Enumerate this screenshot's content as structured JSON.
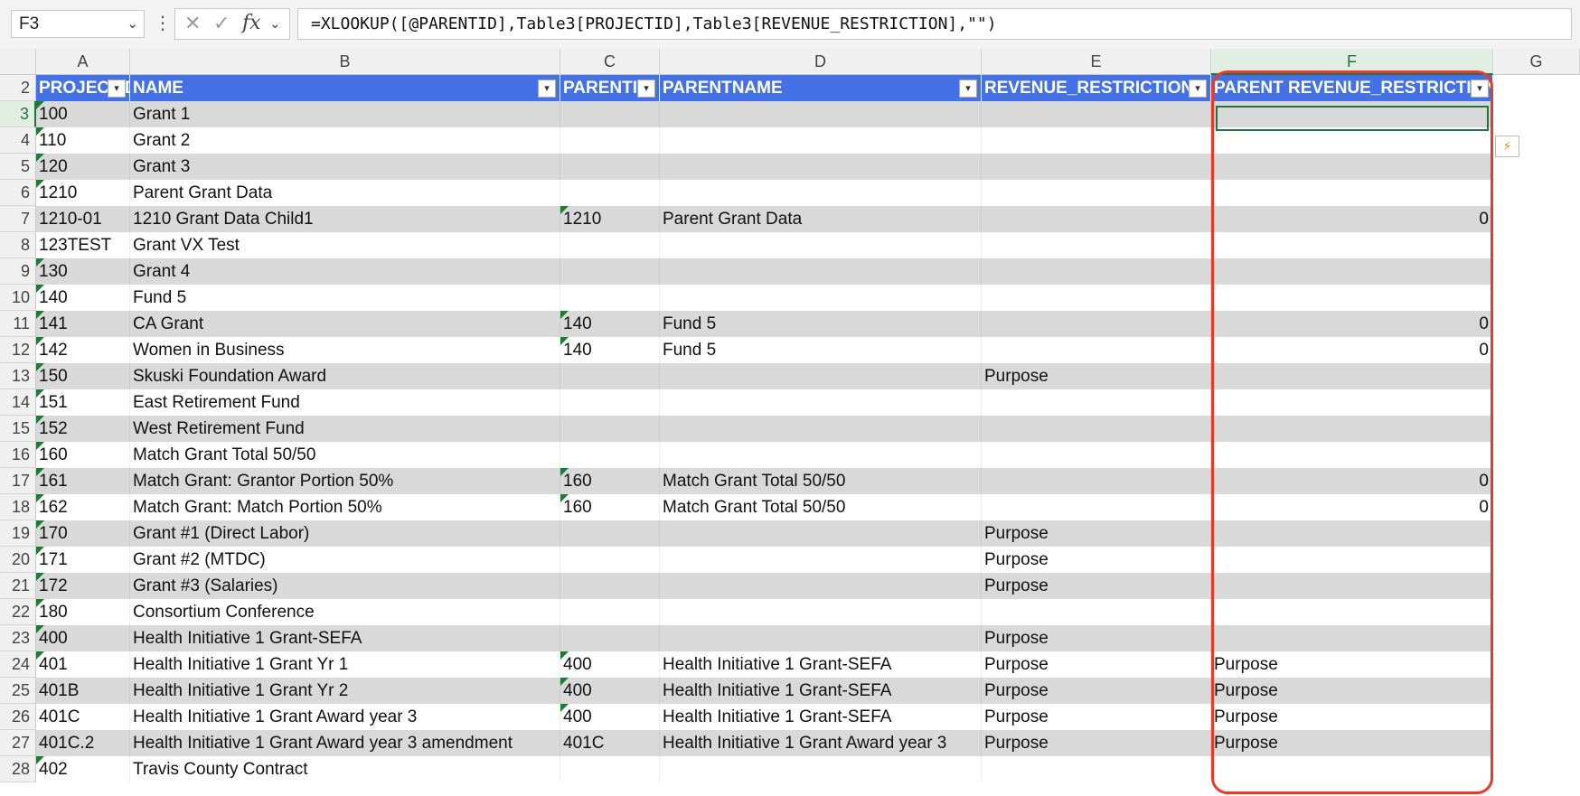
{
  "formula_bar": {
    "cell_ref": "F3",
    "cancel_icon": "✕",
    "enter_icon": "✓",
    "fx_label": "fx",
    "formula": "=XLOOKUP([@PARENTID],Table3[PROJECTID],Table3[REVENUE_RESTRICTION],\"\")"
  },
  "columns": [
    "A",
    "B",
    "C",
    "D",
    "E",
    "F",
    "G"
  ],
  "header_row": {
    "row_number": "2",
    "labels": [
      "PROJECTID",
      "NAME",
      "PARENTID",
      "PARENTNAME",
      "REVENUE_RESTRICTION",
      "PARENT REVENUE_RESTRICTION"
    ]
  },
  "rows": [
    {
      "n": "3",
      "a": "100",
      "b": "Grant 1",
      "c": "",
      "d": "",
      "e": "",
      "f": ""
    },
    {
      "n": "4",
      "a": "110",
      "b": "Grant 2",
      "c": "",
      "d": "",
      "e": "",
      "f": ""
    },
    {
      "n": "5",
      "a": "120",
      "b": "Grant 3",
      "c": "",
      "d": "",
      "e": "",
      "f": ""
    },
    {
      "n": "6",
      "a": "1210",
      "b": "Parent Grant Data",
      "c": "",
      "d": "",
      "e": "",
      "f": ""
    },
    {
      "n": "7",
      "a": "1210-01",
      "b": "1210 Grant Data Child1",
      "c": "1210",
      "d": "Parent Grant Data",
      "e": "",
      "f": "0"
    },
    {
      "n": "8",
      "a": "123TEST",
      "b": "Grant VX Test",
      "c": "",
      "d": "",
      "e": "",
      "f": ""
    },
    {
      "n": "9",
      "a": "130",
      "b": "Grant 4",
      "c": "",
      "d": "",
      "e": "",
      "f": ""
    },
    {
      "n": "10",
      "a": "140",
      "b": "Fund 5",
      "c": "",
      "d": "",
      "e": "",
      "f": ""
    },
    {
      "n": "11",
      "a": "141",
      "b": "CA Grant",
      "c": "140",
      "d": "Fund 5",
      "e": "",
      "f": "0"
    },
    {
      "n": "12",
      "a": "142",
      "b": "Women in Business",
      "c": "140",
      "d": "Fund 5",
      "e": "",
      "f": "0"
    },
    {
      "n": "13",
      "a": "150",
      "b": "Skuski Foundation Award",
      "c": "",
      "d": "",
      "e": "Purpose",
      "f": ""
    },
    {
      "n": "14",
      "a": "151",
      "b": "East Retirement Fund",
      "c": "",
      "d": "",
      "e": "",
      "f": ""
    },
    {
      "n": "15",
      "a": "152",
      "b": "West Retirement Fund",
      "c": "",
      "d": "",
      "e": "",
      "f": ""
    },
    {
      "n": "16",
      "a": "160",
      "b": "Match Grant Total 50/50",
      "c": "",
      "d": "",
      "e": "",
      "f": ""
    },
    {
      "n": "17",
      "a": "161",
      "b": "Match Grant: Grantor Portion 50%",
      "c": "160",
      "d": "Match Grant Total 50/50",
      "e": "",
      "f": "0"
    },
    {
      "n": "18",
      "a": "162",
      "b": "Match Grant: Match Portion 50%",
      "c": "160",
      "d": "Match Grant Total 50/50",
      "e": "",
      "f": "0"
    },
    {
      "n": "19",
      "a": "170",
      "b": "Grant #1 (Direct Labor)",
      "c": "",
      "d": "",
      "e": "Purpose",
      "f": ""
    },
    {
      "n": "20",
      "a": "171",
      "b": "Grant #2 (MTDC)",
      "c": "",
      "d": "",
      "e": "Purpose",
      "f": ""
    },
    {
      "n": "21",
      "a": "172",
      "b": "Grant #3 (Salaries)",
      "c": "",
      "d": "",
      "e": "Purpose",
      "f": ""
    },
    {
      "n": "22",
      "a": "180",
      "b": "Consortium Conference",
      "c": "",
      "d": "",
      "e": "",
      "f": ""
    },
    {
      "n": "23",
      "a": "400",
      "b": "Health Initiative 1 Grant-SEFA",
      "c": "",
      "d": "",
      "e": "Purpose",
      "f": ""
    },
    {
      "n": "24",
      "a": "401",
      "b": "Health Initiative 1 Grant Yr 1",
      "c": "400",
      "d": "Health Initiative 1 Grant-SEFA",
      "e": "Purpose",
      "f": "Purpose"
    },
    {
      "n": "25",
      "a": "401B",
      "b": "Health Initiative 1 Grant Yr 2",
      "c": "400",
      "d": "Health Initiative 1 Grant-SEFA",
      "e": "Purpose",
      "f": "Purpose"
    },
    {
      "n": "26",
      "a": "401C",
      "b": "Health Initiative 1 Grant Award year 3",
      "c": "400",
      "d": "Health Initiative 1 Grant-SEFA",
      "e": "Purpose",
      "f": "Purpose"
    },
    {
      "n": "27",
      "a": "401C.2",
      "b": "Health Initiative 1 Grant Award year 3 amendment",
      "c": "401C",
      "d": "Health Initiative 1 Grant Award year 3",
      "e": "Purpose",
      "f": "Purpose"
    },
    {
      "n": "28",
      "a": "402",
      "b": "Travis County Contract",
      "c": "",
      "d": "",
      "e": "",
      "f": ""
    }
  ],
  "green_triangle_a": [
    "100",
    "110",
    "120",
    "1210",
    "130",
    "140",
    "141",
    "142",
    "150",
    "151",
    "152",
    "160",
    "161",
    "162",
    "170",
    "171",
    "172",
    "180",
    "400",
    "401",
    "402"
  ],
  "green_triangle_c": [
    "1210",
    "140",
    "160",
    "400"
  ],
  "colors": {
    "table_header": "#4472e6",
    "band": "#d9d9d9",
    "highlight": "#e8392a",
    "selection": "#217346"
  }
}
